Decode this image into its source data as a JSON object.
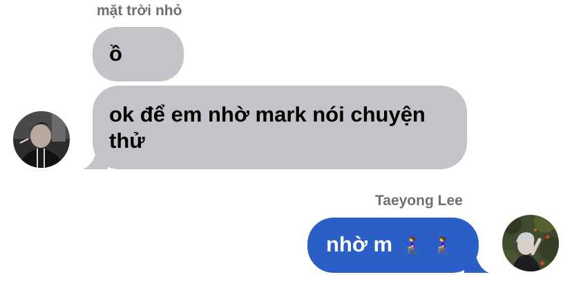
{
  "conversation": {
    "received": {
      "sender_name": "mặt trời nhỏ",
      "messages": [
        {
          "text": "ồ"
        },
        {
          "text": "ok để em nhờ mark nói chuyện thử"
        }
      ],
      "avatar_icon": "dark-jacket-person-photo"
    },
    "sent": {
      "sender_name": "Taeyong Lee",
      "message_text": "nhờ m",
      "emojis": [
        "🧎‍♀️",
        "🧎‍♀️"
      ],
      "avatar_icon": "silver-hair-person-photo"
    }
  },
  "colors": {
    "received_bubble": "#c4c3c8",
    "sent_bubble": "#2b5fc7",
    "sender_name": "#6e6e73"
  }
}
